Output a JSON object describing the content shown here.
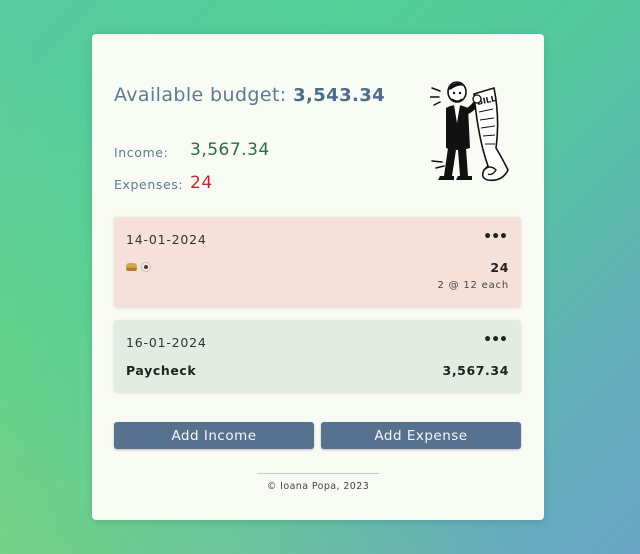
{
  "budget": {
    "title_prefix": "Available budget:",
    "amount": "3,543.34"
  },
  "illustration": {
    "icon": "man-with-bill-illustration",
    "bill_text": "BILL"
  },
  "summary": {
    "income_label": "Income:",
    "income_value": "3,567.34",
    "expenses_label": "Expenses:",
    "expenses_value": "24"
  },
  "entries": [
    {
      "type": "expense",
      "date": "14-01-2024",
      "menu": "•••",
      "icons": [
        "sandwich-emoji-icon",
        "coffee-emoji-icon"
      ],
      "amount": "24",
      "detail": "2 @ 12 each"
    },
    {
      "type": "income",
      "date": "16-01-2024",
      "menu": "•••",
      "name": "Paycheck",
      "amount": "3,567.34"
    }
  ],
  "actions": {
    "add_income": "Add Income",
    "add_expense": "Add Expense"
  },
  "footer": {
    "text": "© Ioana Popa, 2023"
  },
  "colors": {
    "card_bg": "#f8fbf3",
    "expense_bg": "#f5e0da",
    "income_bg": "#e2ece3",
    "button_bg": "#56728f",
    "income_value": "#2d6b45",
    "expenses_value": "#c0272d",
    "label": "#5b7a96"
  }
}
